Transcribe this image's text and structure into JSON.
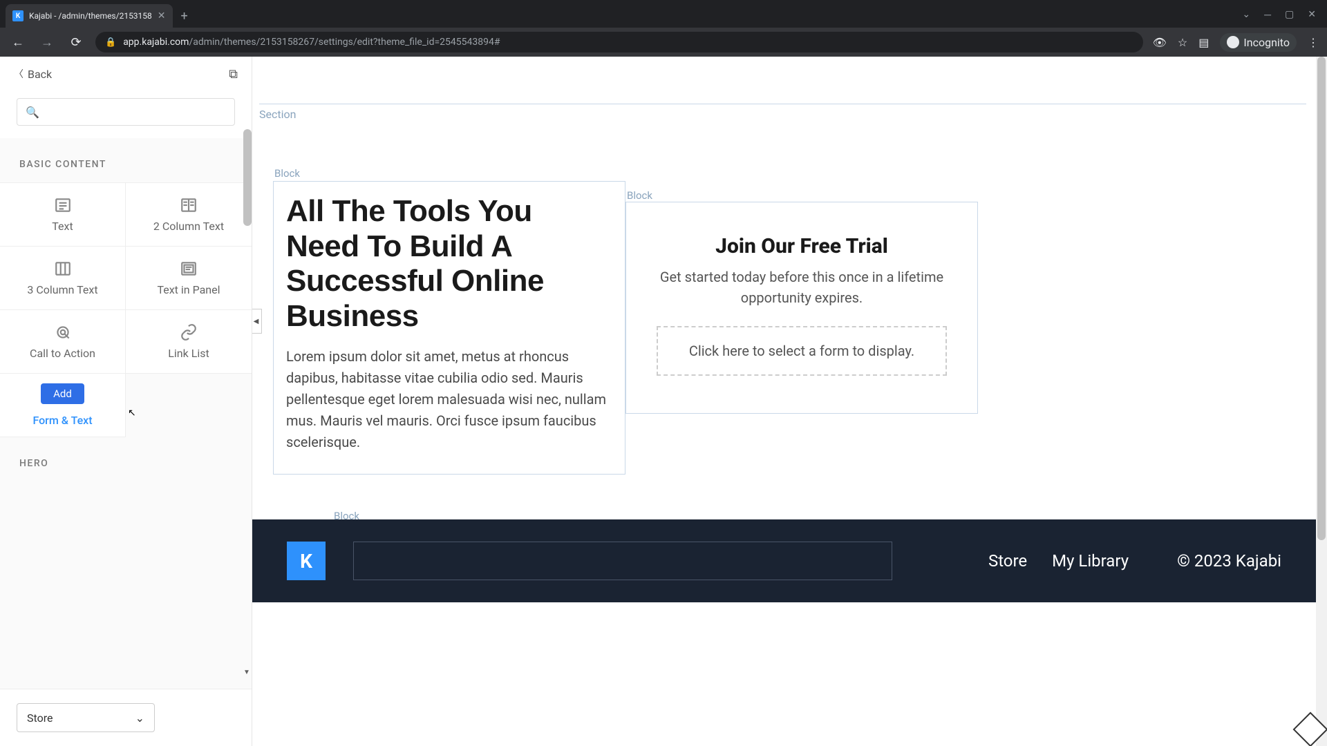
{
  "browser": {
    "tab_title": "Kajabi - /admin/themes/2153158",
    "url_domain": "app.kajabi.com",
    "url_path": "/admin/themes/2153158267/settings/edit?theme_file_id=2545543894#",
    "incognito_label": "Incognito"
  },
  "sidebar": {
    "back_label": "Back",
    "sections": {
      "basic_content_label": "BASIC CONTENT",
      "hero_label": "HERO"
    },
    "cells": {
      "text": "Text",
      "two_col": "2 Column Text",
      "three_col": "3 Column Text",
      "text_panel": "Text in Panel",
      "cta": "Call to Action",
      "link_list": "Link List",
      "form_text": "Form & Text",
      "add_label": "Add"
    },
    "page_select": "Store"
  },
  "canvas": {
    "section_tag": "Section",
    "block_tag": "Block",
    "block1": {
      "heading": "All The Tools You Need To Build A Successful Online Business",
      "body": "Lorem ipsum dolor sit amet, metus at rhoncus dapibus, habitasse vitae cubilia odio sed. Mauris pellentesque eget lorem malesuada wisi nec, nullam mus. Mauris vel mauris. Orci fusce ipsum faucibus scelerisque."
    },
    "block2": {
      "heading": "Join Our Free Trial",
      "body": "Get started today before this once in a lifetime opportunity expires.",
      "form_placeholder": "Click here to select a form to display."
    },
    "footer": {
      "links": [
        "Store",
        "My Library"
      ],
      "copyright": "© 2023 Kajabi"
    }
  }
}
